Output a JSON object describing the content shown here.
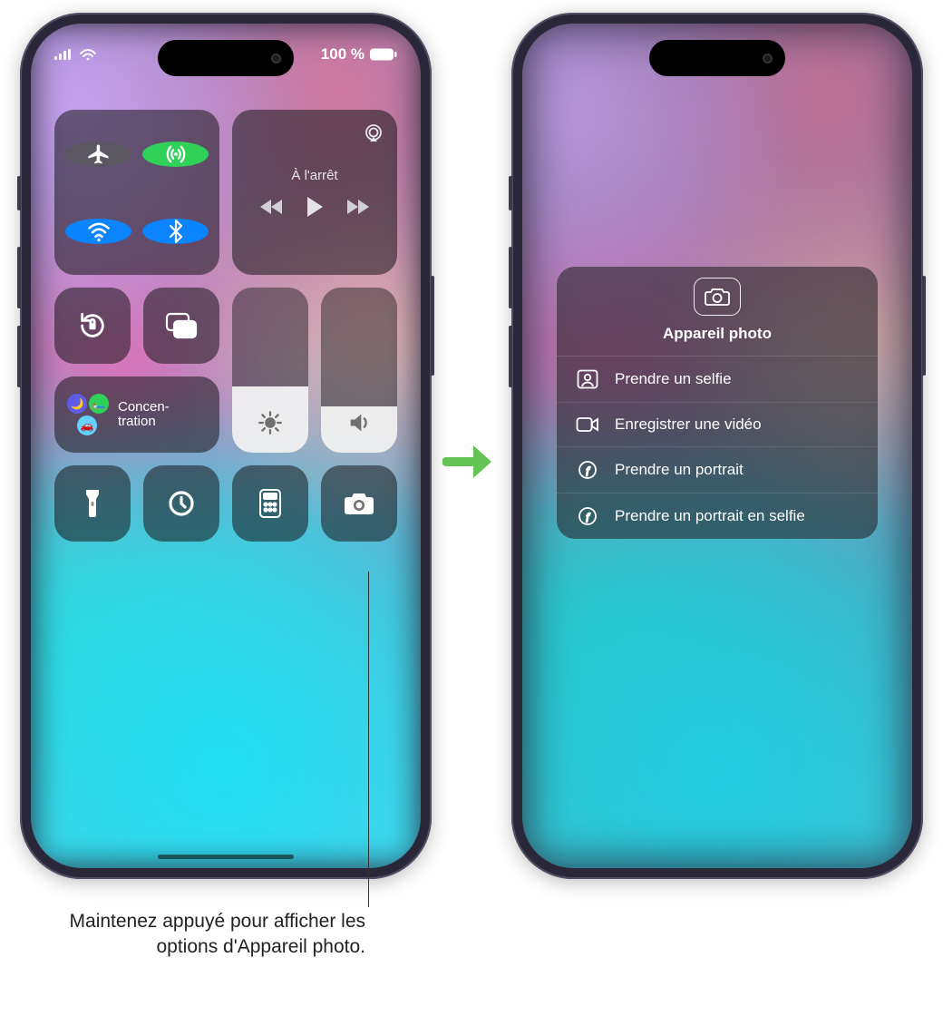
{
  "status": {
    "battery_text": "100 %"
  },
  "control_center": {
    "media": {
      "status": "À l'arrêt"
    },
    "focus": {
      "label": "Concen-\ntration"
    },
    "brightness_pct": 40,
    "volume_pct": 28
  },
  "camera_menu": {
    "title": "Appareil photo",
    "items": [
      {
        "icon": "selfie",
        "label": "Prendre un selfie"
      },
      {
        "icon": "video",
        "label": "Enregistrer une vidéo"
      },
      {
        "icon": "portrait",
        "label": "Prendre un portrait"
      },
      {
        "icon": "portrait",
        "label": "Prendre un portrait en selfie"
      }
    ]
  },
  "callout": "Maintenez appuyé pour afficher les options d'Appareil photo."
}
